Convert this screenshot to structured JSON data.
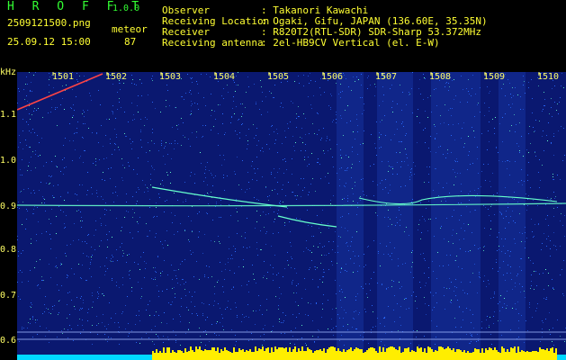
{
  "app": {
    "name": "H R O F F T",
    "version": "1.0.0"
  },
  "file": {
    "name": "2509121500.png",
    "datetime": "25.09.12 15:00"
  },
  "stats": {
    "label": "meteor",
    "count": "87"
  },
  "info": {
    "labels": [
      "Observer",
      "Receiving Location",
      "Receiver",
      "Receiving antenna"
    ],
    "values": [
      ": Takanori Kawachi",
      ": Ogaki, Gifu, JAPAN (136.60E, 35.35N)",
      ": R820T2(RTL-SDR) SDR-Sharp 53.372MHz",
      ": 2el-HB9CV Vertical (el. E-W)"
    ]
  },
  "spectrogram": {
    "y_unit": "kHz",
    "y_ticks": [
      "1.1",
      "1.0",
      "0.9",
      "0.8",
      "0.7",
      "0.6"
    ],
    "x_ticks": [
      "1501",
      "1502",
      "1503",
      "1504",
      "1505",
      "1506",
      "1507",
      "1508",
      "1509",
      "1510"
    ],
    "colors": {
      "background": "#0a1870",
      "noise": "#2b6cff",
      "signal": "#66ffcc",
      "meteor": "#ff4444",
      "baseline": "#00d8ff",
      "burst": "#ffee00"
    }
  }
}
